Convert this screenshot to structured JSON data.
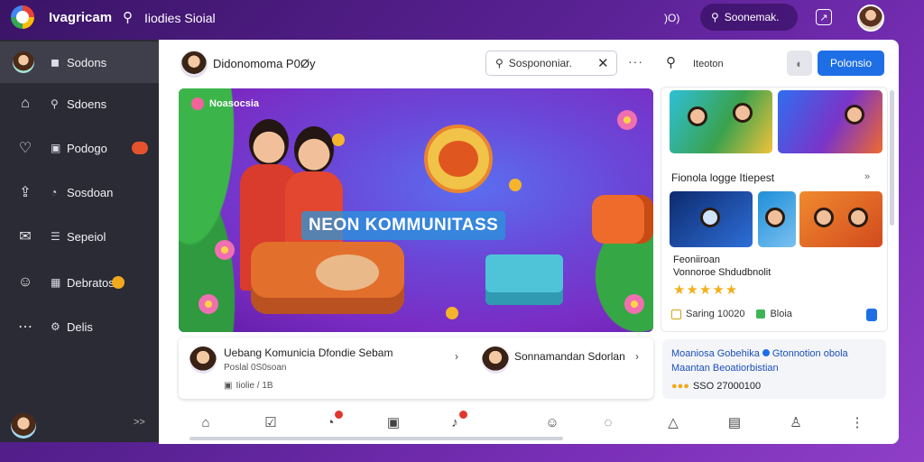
{
  "app": {
    "title": "Ivagricam",
    "section": "Iiodies Sioial"
  },
  "topbar": {
    "count": ")O)",
    "search_label": "Soonemak.",
    "share_icon": "share-icon"
  },
  "sidebar": {
    "items": [
      {
        "label": "Sodons",
        "icon": "avatar"
      },
      {
        "label": "Sdoens",
        "icon": "home-icon"
      },
      {
        "label": "Podogo",
        "icon": "heart-icon"
      },
      {
        "label": "Sosdoan",
        "icon": "upload-icon"
      },
      {
        "label": "Sepeiol",
        "icon": "mail-icon"
      },
      {
        "label": "Debratos",
        "icon": "user-icon"
      },
      {
        "label": "Delis",
        "icon": "more-icon"
      }
    ],
    "collapse_label": ">>"
  },
  "panel": {
    "header": {
      "title": "Didonomoma P0Øy",
      "search_value": "Sospononiar.",
      "search2_label": "Iteoton",
      "primary_button": "Polonsio"
    },
    "banner": {
      "tag": "Noasocsia",
      "title": "NEON KOMMUNITASS"
    },
    "right": {
      "heading": "Fionola logge Itiepest",
      "line1": "Feoniiroan",
      "line2": "Vonnoroe Shdudbnolit",
      "stars": "★★★★★",
      "stat1": "Saring 10020",
      "stat2": "Bloia"
    },
    "card_left": {
      "title": "Uebang Komunicia Dfondie Sebam",
      "sub": "Poslal  0S0soan",
      "meta": "Iiolie / 1B",
      "title2": "Sonnamandan Sdorlan"
    },
    "card_right": {
      "line1a": "Moaniosa Gobehika",
      "line1b": "Gtonnotion obola",
      "line2": "Maantan Beoatiorbistian",
      "price": "SSO 27000100"
    }
  },
  "colors": {
    "accent": "#1e6fe6",
    "sidebar": "#2b2b35",
    "background": "#5b2296"
  }
}
